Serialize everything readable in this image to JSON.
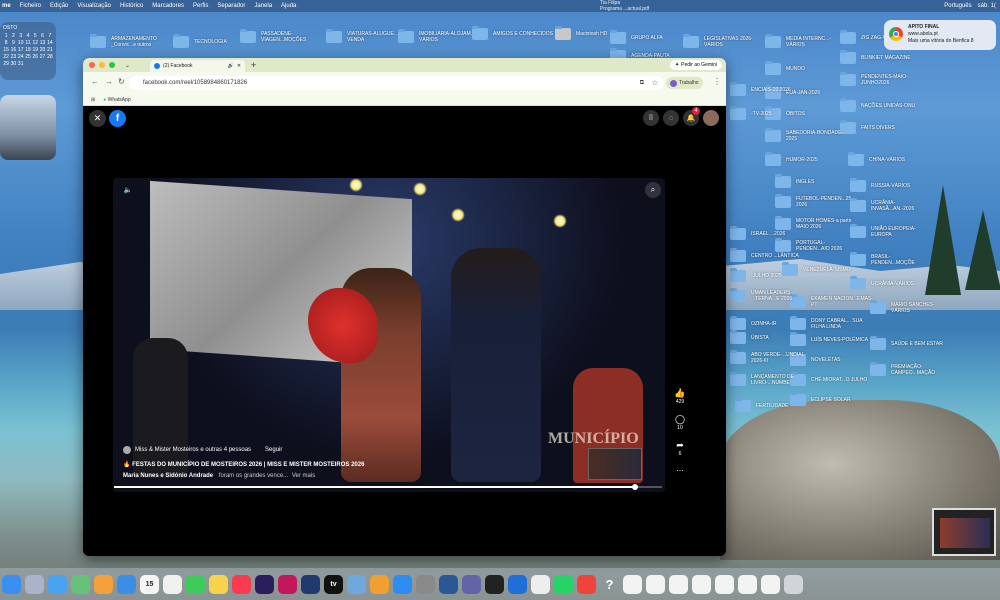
{
  "menubar": {
    "items": [
      "me",
      "Ficheiro",
      "Edição",
      "Visualização",
      "Histórico",
      "Marcadores",
      "Perfis",
      "Separador",
      "Janela",
      "Ajuda"
    ],
    "status_line1": "Tia Filipa",
    "status_line2": "Programa ...actual.pdf",
    "lang": "Português",
    "clock": "sáb. 1("
  },
  "calendar": {
    "month": "OSTO",
    "days": [
      "1",
      "2",
      "3",
      "4",
      "5",
      "6",
      "7",
      "8",
      "9",
      "10",
      "11",
      "12",
      "13",
      "14",
      "15",
      "16",
      "17",
      "18",
      "19",
      "20",
      "21",
      "22",
      "23",
      "24",
      "25",
      "26",
      "27",
      "28",
      "29",
      "30",
      "31"
    ]
  },
  "desktop_folders": [
    {
      "label": "ARMAZENAMENTO _Convic...e outros"
    },
    {
      "label": "TECNOLOGIA"
    },
    {
      "label": "PASSADENE-VIAGEN...MOÇÕES"
    },
    {
      "label": "VIATURAS-ALUGUE...E VENDA"
    },
    {
      "label": "IMOBILIÁRIA-ALOJAM...-VÁRIOS"
    },
    {
      "label": "AMIGOS E CONHECIDOS"
    },
    {
      "label": "Macintosh HD"
    },
    {
      "label": "GRUPO ALFA"
    },
    {
      "label": "LEGISLATIVAS 2026-VÁRIOS"
    },
    {
      "label": "MEDIA INTERNC...-VÁRIOS"
    },
    {
      "label": "ZIG ZAG-V"
    },
    {
      "label": "BLINKIET MAGAZINE"
    },
    {
      "label": "AGENDA-PAUTA"
    },
    {
      "label": "MUNDO"
    },
    {
      "label": "PENDENTES-MAIO-JUNHO2026"
    },
    {
      "label": "EUA-JAN-2026"
    },
    {
      "label": "NAÇÕES UNIDAS-ONU"
    },
    {
      "label": "ÓBITOS"
    },
    {
      "label": "FAITS DIVERS"
    },
    {
      "label": "SABEDORIA-BONDADE-2025"
    },
    {
      "label": "HUMOR-2025"
    },
    {
      "label": "CHINA-VÁRIOS"
    },
    {
      "label": "INGLES"
    },
    {
      "label": "RUSSIA-VÁRIOS"
    },
    {
      "label": "FUTEBOL-PENDEN...25-2026"
    },
    {
      "label": "UCRÂNIA-INVASÃ...AN.-2026"
    },
    {
      "label": "MOTOR HOMES-a partir MAIO 2026"
    },
    {
      "label": "UNIÃO EUROPEIA-EUROPA"
    },
    {
      "label": "PORTUGAL-PENDEN...AIO 2026"
    },
    {
      "label": "BRASIL-PENDEN...MOÇÕE"
    },
    {
      "label": "VENEZUELA-SISMO"
    },
    {
      "label": "UCRÂNIA-VÁRIOS"
    },
    {
      "label": "EKAMEN NACION...EMAS-PT"
    },
    {
      "label": "MÁRIO SANCHES-VÁRIOS"
    },
    {
      "label": "DONY CABRAL... SUA FILHA LINDA"
    },
    {
      "label": "LUÍS NEVES-POLÉMICA"
    },
    {
      "label": "SAÚDE E BEM ESTAR"
    },
    {
      "label": "NOVELETAS"
    },
    {
      "label": "PREMIAÇÃO-CAMPEO...MAÇÃO"
    },
    {
      "label": "CHÉ MIORAT...O JULHO"
    },
    {
      "label": "ECLIPSE SOLAR"
    },
    {
      "label": "FERTILIDADE"
    },
    {
      "label": "ENCIAIS-20 2026"
    },
    {
      "label": "-TV-2025"
    },
    {
      "label": "ISRAEL ...2026"
    },
    {
      "label": "CENTRO ...LÂNTICA"
    },
    {
      "label": "-JULHO 2025"
    },
    {
      "label": "UMAN LEADERS ...TERNA...E 2026"
    },
    {
      "label": "OZINHA-IR"
    },
    {
      "label": "ÚBISTA"
    },
    {
      "label": "ABO VERDE-...UNDIAL 2026-III"
    },
    {
      "label": "LANÇAMENTO DE LIVRO-...NUMBE"
    }
  ],
  "notification": {
    "title": "APITO FINAL",
    "site": "www.abola.pt",
    "body": "Mais uma vitória do Benfica 8"
  },
  "browser": {
    "tab_title": "(2) Facebook",
    "new_tab": "+",
    "gemini": "Pedir ao Gemini",
    "url": "facebook.com/reel/1058984860171826",
    "profile": "Trabalho",
    "bookmark": "WhatsApp",
    "notif_count": "4"
  },
  "reel": {
    "author": "Miss & Mister Mosteiros e outras 4 pessoas",
    "follow": "Seguir",
    "caption": "FESTAS DO MUNICÍPIO DE MOSTEIROS 2026 | MISS E MISTER MOSTEIROS 2026",
    "names": "Maria Nunes e Sidónio Andrade",
    "desc": "foram os grandes vence...",
    "more": "Ver mais",
    "likes": "429",
    "comments": "10",
    "shares": "6",
    "overlay": "MUNICÍPIO",
    "progress_fraction": 0.95
  },
  "dock": {
    "items": [
      "finder",
      "launchpad",
      "mail",
      "maps",
      "photos",
      "safari",
      "calendar",
      "reminders",
      "facetime",
      "notes",
      "music",
      "premiere",
      "indesign",
      "photoshop",
      "tv",
      "preview",
      "pages",
      "appstore",
      "settings",
      "word",
      "teams",
      "terminal",
      "quicktime",
      "chrome",
      "whatsapp",
      "anydesk",
      "help",
      "doc1",
      "doc2",
      "doc3",
      "doc4",
      "doc5",
      "doc6",
      "doc7",
      "trash"
    ],
    "calendar_day": "15",
    "tv_label": "tv",
    "help_label": "?"
  },
  "colors": {
    "accent": "#1877f2",
    "tabbar": "#dfe9c8"
  }
}
